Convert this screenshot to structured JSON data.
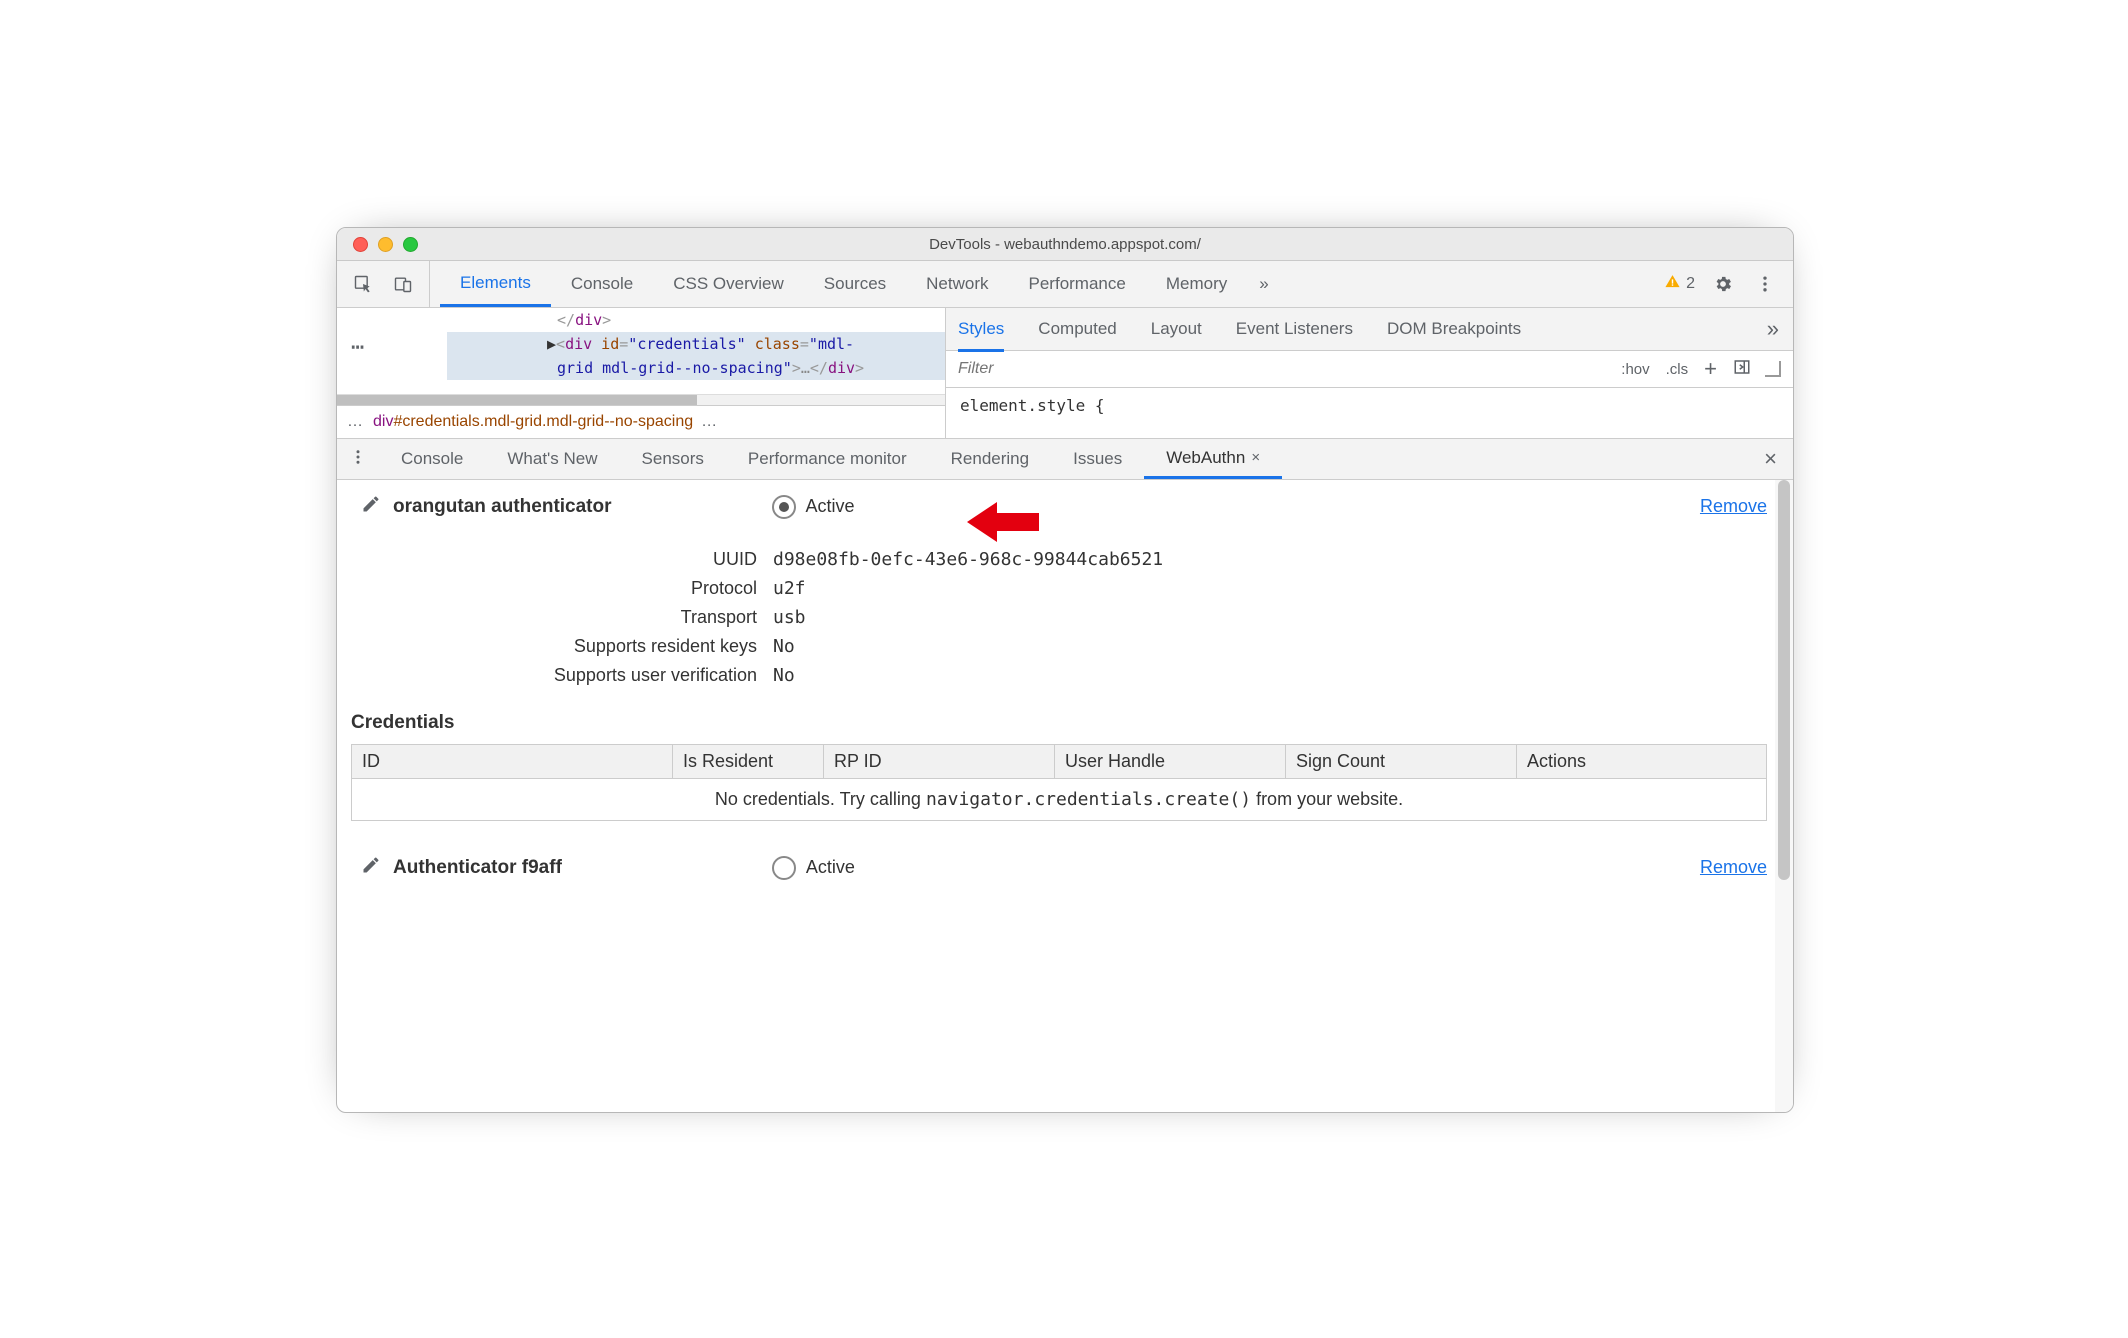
{
  "titlebar": {
    "title": "DevTools - webauthndemo.appspot.com/"
  },
  "top_tabs": {
    "elements": "Elements",
    "console": "Console",
    "css_overview": "CSS Overview",
    "sources": "Sources",
    "network": "Network",
    "performance": "Performance",
    "memory": "Memory"
  },
  "top_more_glyph": "»",
  "warn_count": "2",
  "elements_code": {
    "line1_open": "<",
    "line1_slash": "/",
    "line1_tag": "div",
    "line1_close": ">",
    "line2_tri": "▶",
    "line2_open": "<",
    "line2_tag": "div",
    "line2_id_attr": " id",
    "line2_eq": "=",
    "line2_id_val_open": "\"",
    "line2_id_val": "credentials",
    "line2_id_val_close": "\"",
    "line2_class_attr": " class",
    "line2_class_val_open": "\"",
    "line2_class_val_a": "mdl-",
    "line2_class_val_b": "grid mdl-grid--no-spacing",
    "line2_close1": ">",
    "line2_ell": "…",
    "line2_end_open": "<",
    "line2_end_slash": "/",
    "line2_end_tag": "div",
    "line2_end_close": ">"
  },
  "crumbs": {
    "dots_l": "…",
    "main": "div#credentials.mdl-grid.mdl-grid--no-spacing",
    "dots_r": "…"
  },
  "styles_tabs": {
    "styles": "Styles",
    "computed": "Computed",
    "layout": "Layout",
    "event_listeners": "Event Listeners",
    "dom_breakpoints": "DOM Breakpoints"
  },
  "styles_more": "»",
  "filter_placeholder": "Filter",
  "hov_label": ":hov",
  "cls_label": ".cls",
  "element_style": "element.style {",
  "lower_tabs": {
    "console": "Console",
    "whats_new": "What's New",
    "sensors": "Sensors",
    "perfmon": "Performance monitor",
    "rendering": "Rendering",
    "issues": "Issues",
    "webauthn": "WebAuthn"
  },
  "webauthn_close": "×",
  "panel_close": "×",
  "auth": {
    "name": "orangutan authenticator",
    "active_label": "Active",
    "remove": "Remove",
    "uuid_k": "UUID",
    "uuid_v": "d98e08fb-0efc-43e6-968c-99844cab6521",
    "proto_k": "Protocol",
    "proto_v": "u2f",
    "trans_k": "Transport",
    "trans_v": "usb",
    "resident_k": "Supports resident keys",
    "resident_v": "No",
    "userver_k": "Supports user verification",
    "userver_v": "No"
  },
  "cred": {
    "heading": "Credentials",
    "th_id": "ID",
    "th_resident": "Is Resident",
    "th_rpid": "RP ID",
    "th_handle": "User Handle",
    "th_sign": "Sign Count",
    "th_actions": "Actions",
    "empty_pre": "No credentials. Try calling ",
    "empty_code": "navigator.credentials.create()",
    "empty_post": " from your website."
  },
  "auth2": {
    "name": "Authenticator f9aff",
    "active_label": "Active",
    "remove": "Remove"
  }
}
